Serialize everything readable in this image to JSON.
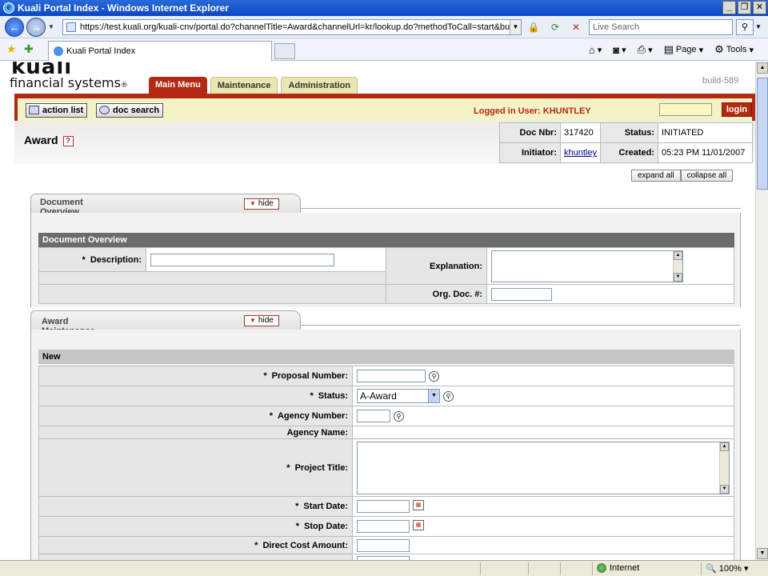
{
  "window": {
    "title": "Kuali Portal Index - Windows Internet Explorer",
    "url": "https://test.kuali.org/kuali-cnv/portal.do?channelTitle=Award&channelUrl=kr/lookup.do?methodToCall=start&businessObj",
    "search_placeholder": "Live Search",
    "tab_title": "Kuali Portal Index",
    "cmd_page": "Page",
    "cmd_tools": "Tools"
  },
  "header": {
    "logo_top": "kuali",
    "logo_sub": "financial systems",
    "logo_reg": "®",
    "tabs": [
      {
        "label": "Main Menu",
        "active": true
      },
      {
        "label": "Maintenance",
        "active": false
      },
      {
        "label": "Administration",
        "active": false
      }
    ],
    "build": "build-589"
  },
  "toolbar": {
    "action_list": "action list",
    "doc_search": "doc search",
    "logged_in": "Logged in User: KHUNTLEY",
    "login": "login"
  },
  "document": {
    "title": "Award",
    "help": "?",
    "doc_nbr_label": "Doc Nbr:",
    "doc_nbr": "317420",
    "status_label": "Status:",
    "status": "INITIATED",
    "initiator_label": "Initiator:",
    "initiator": "khuntley",
    "created_label": "Created:",
    "created": "05:23 PM 11/01/2007"
  },
  "controls": {
    "expand_all": "expand all",
    "collapse_all": "collapse all",
    "hide": "hide"
  },
  "doc_overview": {
    "tab_title": "Document Overview",
    "section_title": "Document Overview",
    "required_mark": "*",
    "description_label": "Description:",
    "explanation_label": "Explanation:",
    "org_doc_label": "Org. Doc. #:"
  },
  "award_maintenance": {
    "tab_title": "Award Maintenance",
    "section_title": "New",
    "fields": {
      "proposal_number": "Proposal Number:",
      "status": "Status:",
      "status_value": "A-Award",
      "agency_number": "Agency Number:",
      "agency_name": "Agency Name:",
      "project_title": "Project Title:",
      "start_date": "Start Date:",
      "stop_date": "Stop Date:",
      "direct_cost": "Direct Cost Amount:"
    }
  },
  "statusbar": {
    "zone": "Internet",
    "zoom": "100%"
  }
}
